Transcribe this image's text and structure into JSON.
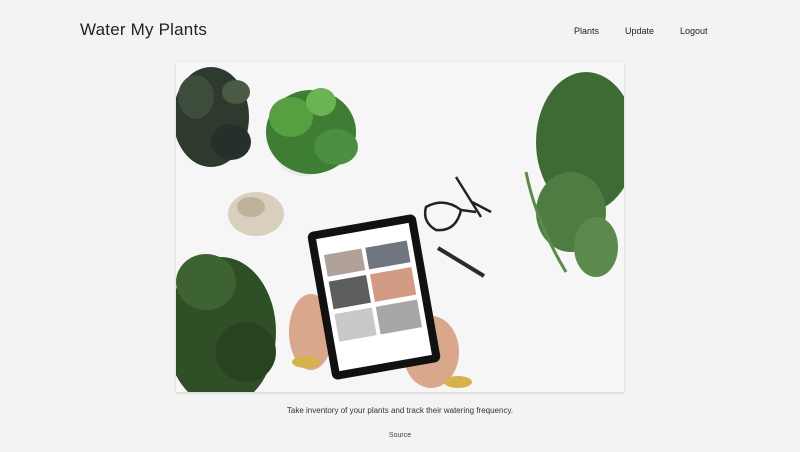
{
  "header": {
    "brand": "Water My Plants",
    "nav": [
      "Plants",
      "Update",
      "Logout"
    ]
  },
  "hero": {
    "image": "plants-and-tablet-photo"
  },
  "caption": "Take inventory of your plants and track their watering frequency.",
  "source_link": "Source"
}
